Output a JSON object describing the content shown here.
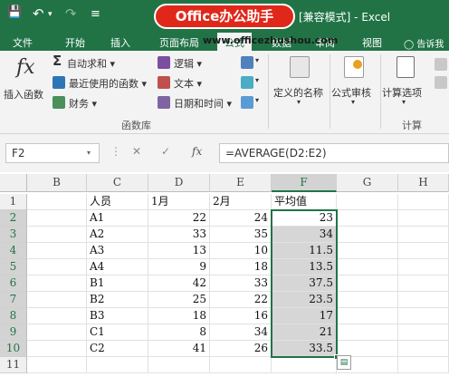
{
  "title_bar": {
    "qat_save": "💾",
    "qat_undo": "↶",
    "qat_undo_arrow": "▾",
    "qat_redo": "↷",
    "qat_customize": "≡",
    "doc_title": "[兼容模式] - Excel",
    "logo_text": "Office办公助手"
  },
  "watermark": "www.officezhushou.com",
  "tabs": [
    {
      "label": "文件"
    },
    {
      "label": "开始"
    },
    {
      "label": "插入"
    },
    {
      "label": "页面布局"
    },
    {
      "label": "公式"
    },
    {
      "label": "数据"
    },
    {
      "label": "审阅"
    },
    {
      "label": "视图"
    },
    {
      "label": "告诉我"
    }
  ],
  "ribbon": {
    "insert_function": {
      "icon": "fx",
      "label": "插入函数"
    },
    "autosum": {
      "icon": "Σ",
      "label": "自动求和 ▾"
    },
    "recent": {
      "label": "最近使用的函数 ▾"
    },
    "finance": {
      "label": "财务 ▾"
    },
    "logic": {
      "label": "逻辑 ▾"
    },
    "text": {
      "label": "文本 ▾"
    },
    "datetime": {
      "label": "日期和时间 ▾"
    },
    "more_arrow": "▾",
    "defined_names": {
      "label": "定义的名称"
    },
    "formula_audit": {
      "label": "公式审核"
    },
    "calc_options": {
      "label": "计算选项"
    },
    "group_library": "函数库",
    "group_calc": "计算",
    "dropdown_arrow": "▾"
  },
  "formula_bar": {
    "name_box": "F2",
    "name_arrow": "▾",
    "dots": "⋮",
    "cancel": "✕",
    "enter": "✓",
    "fx": "fx",
    "formula": "=AVERAGE(D2:E2)"
  },
  "columns": [
    "B",
    "C",
    "D",
    "E",
    "F",
    "G",
    "H"
  ],
  "rows": [
    "1",
    "2",
    "3",
    "4",
    "5",
    "6",
    "7",
    "8",
    "9",
    "10",
    "11"
  ],
  "header_row": {
    "C": "人员",
    "D": "1月",
    "E": "2月",
    "F": "平均值"
  },
  "table": [
    {
      "C": "A1",
      "D": "22",
      "E": "24",
      "F": "23"
    },
    {
      "C": "A2",
      "D": "33",
      "E": "35",
      "F": "34"
    },
    {
      "C": "A3",
      "D": "13",
      "E": "10",
      "F": "11.5"
    },
    {
      "C": "A4",
      "D": "9",
      "E": "18",
      "F": "13.5"
    },
    {
      "C": "B1",
      "D": "42",
      "E": "33",
      "F": "37.5"
    },
    {
      "C": "B2",
      "D": "25",
      "E": "22",
      "F": "23.5"
    },
    {
      "C": "B3",
      "D": "18",
      "E": "16",
      "F": "17"
    },
    {
      "C": "C1",
      "D": "8",
      "E": "34",
      "F": "21"
    },
    {
      "C": "C2",
      "D": "41",
      "E": "26",
      "F": "33.5"
    }
  ],
  "quick_analysis_icon": "▤",
  "colors": {
    "excel_green": "#217346",
    "logo_red": "#e0281a",
    "selection_gray": "#d6d6d6"
  }
}
